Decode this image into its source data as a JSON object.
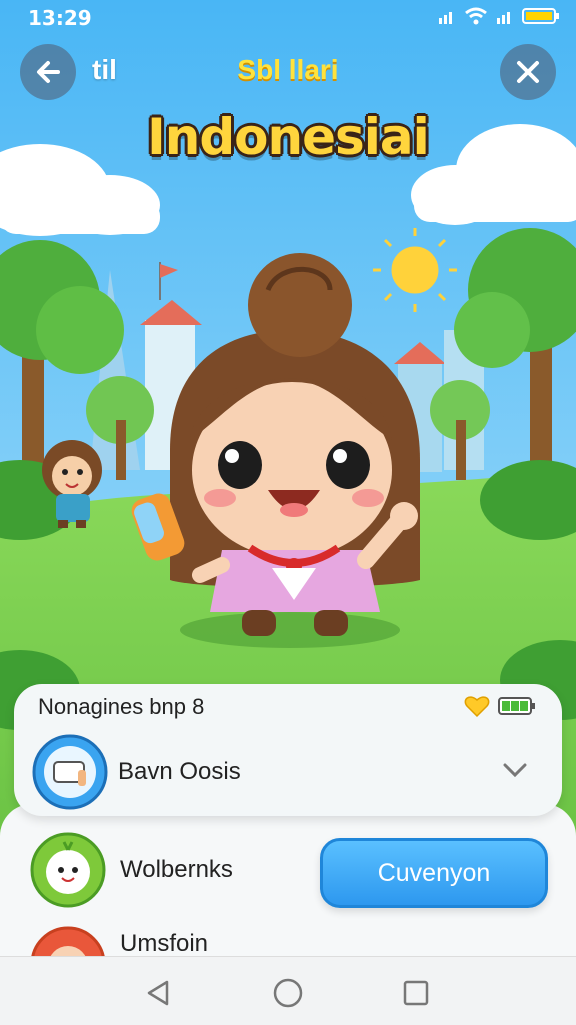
{
  "status": {
    "time": "13:29",
    "icons": [
      "signal-bars-icon",
      "wifi-icon",
      "signal-bars-icon",
      "wifi-icon",
      "signal-bars-icon",
      "battery-icon"
    ]
  },
  "topbar": {
    "left_label": "til",
    "center_label": "Sbl llari",
    "back_icon": "arrow-left-icon",
    "close_icon": "close-icon"
  },
  "headline": "Indonesiai",
  "panel": {
    "title": "Nonagines bnp 8",
    "row1_label": "Bavn Oosis",
    "icons": [
      "heart-icon",
      "battery-icon",
      "chevron-down-icon"
    ]
  },
  "sheet": {
    "row2_label": "Wolbernks",
    "row3_label": "Umsfoin",
    "action_label": "Cuvenyon"
  },
  "navbar": {
    "icons": [
      "back-triangle-icon",
      "home-circle-icon",
      "recents-square-icon"
    ]
  },
  "colors": {
    "sky": "#8fd3f7",
    "grass": "#7ccf4e",
    "accent_blue": "#2d98ef",
    "title_yellow": "#ffd53d"
  }
}
